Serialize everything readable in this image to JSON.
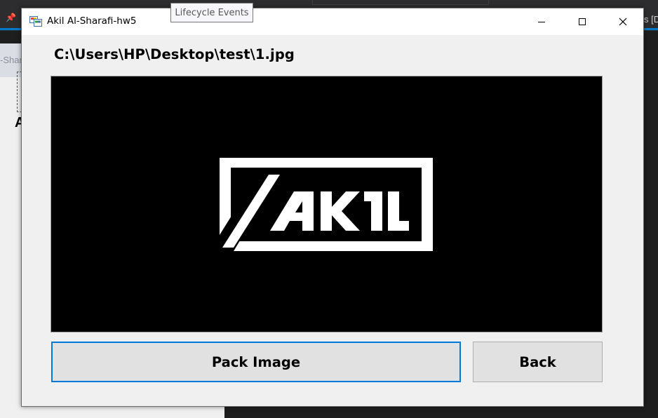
{
  "background_ide": {
    "right_tab_text": "s [D",
    "designer_title": "-Shar",
    "designer_letter": "A"
  },
  "tooltip": {
    "text": "Lifecycle Events"
  },
  "window": {
    "title": "Akil Al-Sharafi-hw5",
    "controls": {
      "minimize_icon": "minimize-icon",
      "maximize_icon": "maximize-icon",
      "close_icon": "close-icon"
    }
  },
  "main": {
    "file_path": "C:\\Users\\HP\\Desktop\\test\\1.jpg",
    "picture": {
      "logo_text": "AKIL",
      "background": "#000000",
      "foreground": "#ffffff"
    },
    "pack_button_label": "Pack Image",
    "back_button_label": "Back"
  },
  "colors": {
    "focus_border": "#0078d7",
    "button_face": "#e1e1e1",
    "window_bg": "#f0f0f0"
  }
}
